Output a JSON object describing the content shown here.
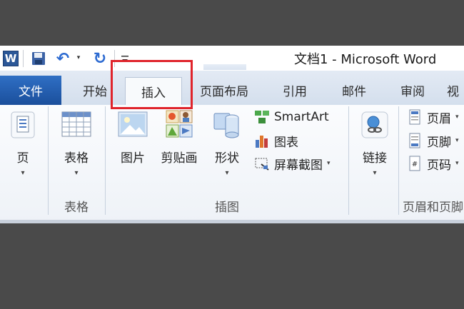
{
  "window": {
    "title": "文档1  -  Microsoft Word",
    "app_icon_letter": "W"
  },
  "qat": {
    "icons": [
      "save-icon",
      "undo-icon",
      "redo-icon"
    ],
    "dropdown_glyph": "▾",
    "undo_glyph": "↶",
    "redo_glyph": "↻"
  },
  "tabs": {
    "file": "文件",
    "items": [
      "开始",
      "插入",
      "页面布局",
      "引用",
      "邮件",
      "审阅",
      "视"
    ],
    "active": "插入"
  },
  "ribbon": {
    "page_group": {
      "button": "页",
      "label": ""
    },
    "tables_group": {
      "button": "表格",
      "label": "表格"
    },
    "illustrations_group": {
      "picture": "图片",
      "clipart": "剪贴画",
      "shapes": "形状",
      "smartart": "SmartArt",
      "chart": "图表",
      "screenshot": "屏幕截图",
      "label": "插图"
    },
    "links_group": {
      "button": "链接",
      "label": ""
    },
    "header_footer_group": {
      "header": "页眉",
      "footer": "页脚",
      "page_number": "页码",
      "label": "页眉和页脚"
    },
    "arrow": "▾"
  },
  "colors": {
    "file_tab": "#2b66b8",
    "highlight": "#e0242b",
    "background": "#4a4a4a"
  }
}
